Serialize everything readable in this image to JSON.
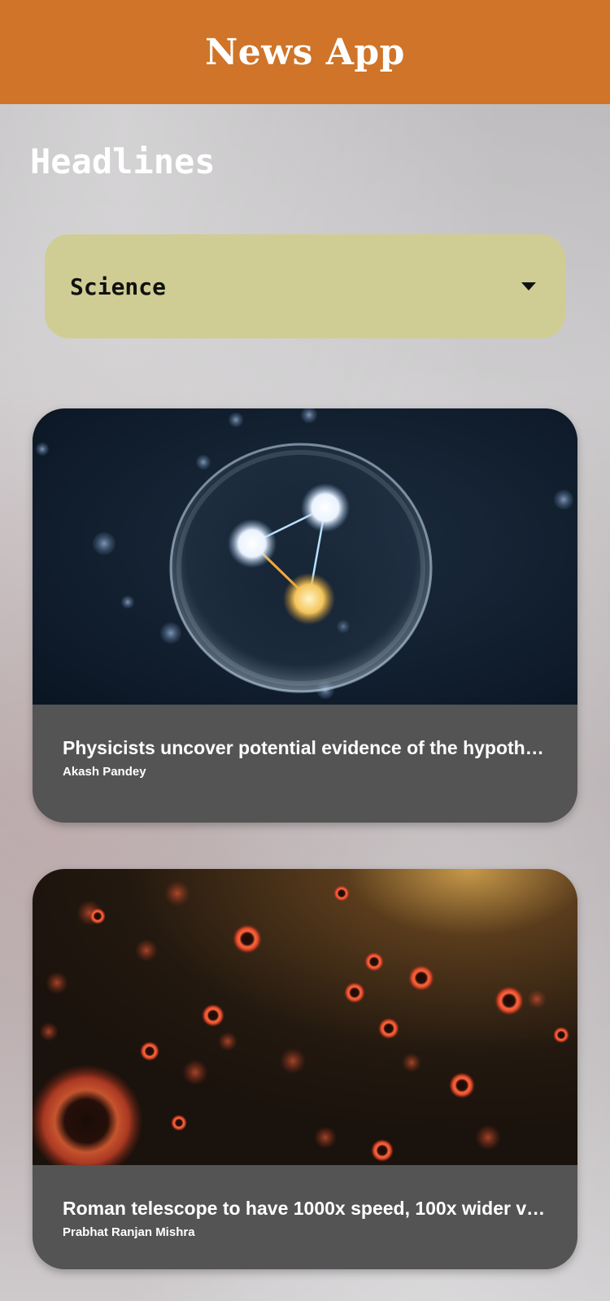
{
  "app_bar": {
    "title": "News App",
    "color": "#cf7428"
  },
  "page": {
    "heading": "Headlines"
  },
  "category_select": {
    "selected": "Science",
    "icon": "caret-down-icon"
  },
  "articles": [
    {
      "title": "Physicists uncover potential evidence of the hypoth…",
      "author": "Akash Pandey",
      "image": "molecule-bubble-illustration"
    },
    {
      "title": "Roman telescope to have 1000x speed, 100x wider v…",
      "author": "Prabhat Ranjan Mishra",
      "image": "red-black-holes-field-illustration"
    }
  ]
}
